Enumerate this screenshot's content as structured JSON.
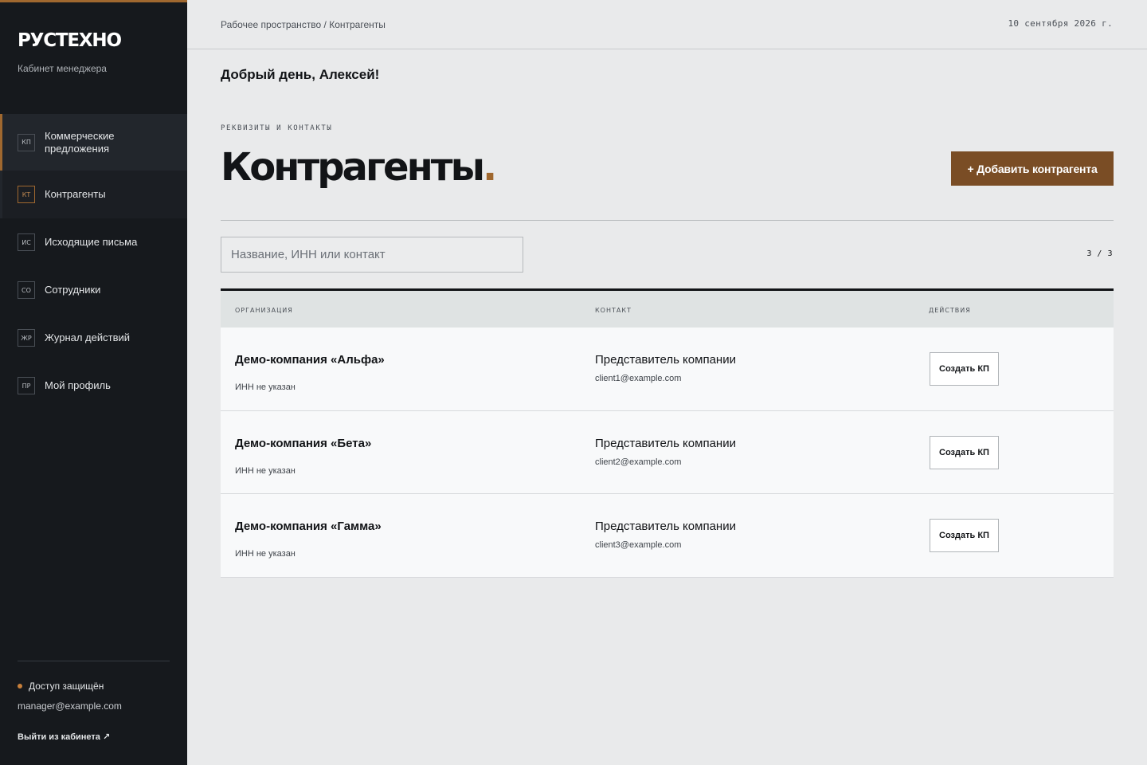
{
  "sidebar": {
    "brand": "РУСТЕХНО",
    "subtitle": "Кабинет менеджера",
    "items": [
      {
        "badge": "КП",
        "label": "Коммерческие предложения"
      },
      {
        "badge": "КТ",
        "label": "Контрагенты"
      },
      {
        "badge": "ИС",
        "label": "Исходящие письма"
      },
      {
        "badge": "СО",
        "label": "Сотрудники"
      },
      {
        "badge": "ЖР",
        "label": "Журнал действий"
      },
      {
        "badge": "ПР",
        "label": "Мой профиль"
      }
    ],
    "access": "Доступ защищён",
    "email": "manager@example.com",
    "logout": "Выйти из кабинета ↗"
  },
  "header": {
    "breadcrumb": "Рабочее пространство / Контрагенты",
    "date": "10 сентября 2026 г."
  },
  "main": {
    "greeting": "Добрый день, Алексей!",
    "eyebrow": "РЕКВИЗИТЫ И КОНТАКТЫ",
    "title": "Контрагенты",
    "title_dot": ".",
    "add_button": "+ Добавить контрагента",
    "search_placeholder": "Название, ИНН или контакт",
    "count": "3 / 3"
  },
  "table": {
    "columns": [
      "ОРГАНИЗАЦИЯ",
      "КОНТАКТ",
      "ДЕЙСТВИЯ"
    ],
    "rows": [
      {
        "org": "Демо-компания «Альфа»",
        "inn": "ИНН не указан",
        "contact": "Представитель компании",
        "email": "client1@example.com",
        "action": "Создать КП"
      },
      {
        "org": "Демо-компания «Бета»",
        "inn": "ИНН не указан",
        "contact": "Представитель компании",
        "email": "client2@example.com",
        "action": "Создать КП"
      },
      {
        "org": "Демо-компания «Гамма»",
        "inn": "ИНН не указан",
        "contact": "Представитель компании",
        "email": "client3@example.com",
        "action": "Создать КП"
      }
    ]
  },
  "colors": {
    "sidebar_bg": "#16191d",
    "accent": "#a0682f",
    "primary_button": "#7a4d25",
    "page_bg": "#e9eaeb"
  }
}
